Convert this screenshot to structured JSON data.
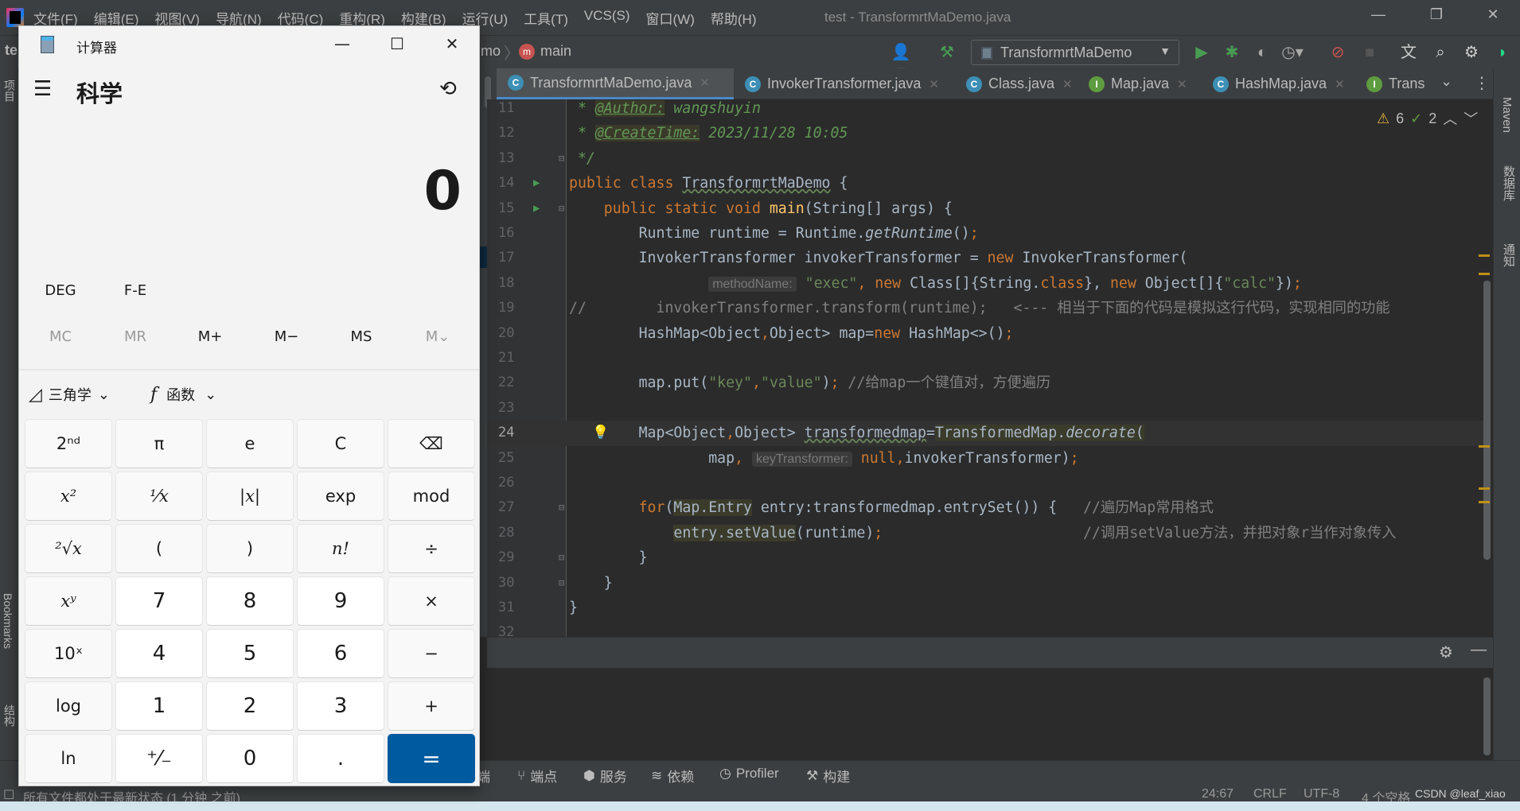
{
  "menubar": {
    "items": [
      "文件(F)",
      "编辑(E)",
      "视图(V)",
      "导航(N)",
      "代码(C)",
      "重构(R)",
      "构建(B)",
      "运行(U)",
      "工具(T)",
      "VCS(S)",
      "窗口(W)",
      "帮助(H)"
    ],
    "title": "test - TransformrtMaDemo.java"
  },
  "toolbar": {
    "breadcrumb_project": "te",
    "breadcrumb_class": "mo",
    "breadcrumb_method": "main",
    "run_config": "TransformrtMaDemo"
  },
  "tabs": [
    {
      "label": "TransformrtMaDemo.java",
      "icon": "C",
      "color": "#3d8fb5",
      "active": true
    },
    {
      "label": "InvokerTransformer.java",
      "icon": "C",
      "color": "#3d8fb5"
    },
    {
      "label": "Class.java",
      "icon": "C",
      "color": "#3d8fb5"
    },
    {
      "label": "Map.java",
      "icon": "I",
      "color": "#5e9c3f"
    },
    {
      "label": "HashMap.java",
      "icon": "C",
      "color": "#3d8fb5"
    },
    {
      "label": "Trans",
      "icon": "I",
      "color": "#5e9c3f"
    }
  ],
  "inspections": {
    "warnings": "6",
    "weak_warnings": "2"
  },
  "code": [
    {
      "n": "11",
      "t": [
        [
          " * ",
          "doc"
        ],
        [
          "@Author:",
          "doctag"
        ],
        [
          " wangshuyin",
          "doc"
        ]
      ]
    },
    {
      "n": "12",
      "t": [
        [
          " * ",
          "doc"
        ],
        [
          "@CreateTime:",
          "doctag"
        ],
        [
          " 2023/11/28 10:05",
          "doc"
        ]
      ]
    },
    {
      "n": "13",
      "t": [
        [
          " */",
          "doc"
        ]
      ],
      "fold": true
    },
    {
      "n": "14",
      "t": [
        [
          "public class ",
          "kw"
        ],
        [
          "TransformrtMaDemo",
          "wavy"
        ],
        [
          " {",
          ""
        ]
      ],
      "run": true
    },
    {
      "n": "15",
      "t": [
        [
          "    public static void ",
          "kw"
        ],
        [
          "main",
          "fn"
        ],
        [
          "(String[] args) {",
          ""
        ]
      ],
      "run": true,
      "fold": true
    },
    {
      "n": "16",
      "t": [
        [
          "        Runtime runtime = Runtime.",
          ""
        ],
        [
          "getRuntime",
          "ital"
        ],
        [
          "()",
          ""
        ],
        [
          ";",
          "kw"
        ]
      ]
    },
    {
      "n": "17",
      "t": [
        [
          "        InvokerTransformer invokerTransformer = ",
          ""
        ],
        [
          "new ",
          "kw"
        ],
        [
          "InvokerTransformer(",
          ""
        ]
      ]
    },
    {
      "n": "18",
      "t": [
        [
          "                ",
          ""
        ],
        [
          "methodName:",
          "hint"
        ],
        [
          " ",
          ""
        ],
        [
          "\"exec\"",
          "str"
        ],
        [
          ", ",
          "kw"
        ],
        [
          "new ",
          "kw"
        ],
        [
          "Class[]{String.",
          ""
        ],
        [
          "class",
          "kw"
        ],
        [
          "}, ",
          ""
        ],
        [
          "new ",
          "kw"
        ],
        [
          "Object[]{",
          ""
        ],
        [
          "\"calc\"",
          "str"
        ],
        [
          "})",
          ""
        ],
        [
          ";",
          "kw"
        ]
      ]
    },
    {
      "n": "19",
      "t": [
        [
          "//        invokerTransformer.transform(runtime);   <--- 相当于下面的代码是模拟这行代码，实现相同的功能",
          "cmt"
        ]
      ]
    },
    {
      "n": "20",
      "t": [
        [
          "        HashMap<Object",
          ""
        ],
        [
          ",",
          "kw"
        ],
        [
          "Object> map=",
          ""
        ],
        [
          "new ",
          "kw"
        ],
        [
          "HashMap<>()",
          ""
        ],
        [
          ";",
          "kw"
        ]
      ]
    },
    {
      "n": "21",
      "t": []
    },
    {
      "n": "22",
      "t": [
        [
          "        map.put(",
          ""
        ],
        [
          "\"key\"",
          "str"
        ],
        [
          ",",
          "kw"
        ],
        [
          "\"value\"",
          "str"
        ],
        [
          ")",
          ""
        ],
        [
          "; ",
          "kw"
        ],
        [
          "//给map一个键值对，方便遍历",
          "cmt"
        ]
      ]
    },
    {
      "n": "23",
      "t": []
    },
    {
      "n": "24",
      "t": [
        [
          "        Map<Object",
          ""
        ],
        [
          ",",
          "kw"
        ],
        [
          "Object> ",
          ""
        ],
        [
          "transformedmap",
          "wavy"
        ],
        [
          "=",
          ""
        ],
        [
          "TransformedMap.",
          "hl"
        ],
        [
          "decorate",
          "hl ital"
        ],
        [
          "(",
          "hl"
        ]
      ],
      "current": true,
      "bulb": true
    },
    {
      "n": "25",
      "t": [
        [
          "                map",
          ""
        ],
        [
          ", ",
          "kw"
        ],
        [
          "keyTransformer:",
          "hint"
        ],
        [
          " null",
          "kw"
        ],
        [
          ",",
          "kw"
        ],
        [
          "invokerTransformer)",
          ""
        ],
        [
          ";",
          "kw"
        ]
      ]
    },
    {
      "n": "26",
      "t": []
    },
    {
      "n": "27",
      "t": [
        [
          "        ",
          ""
        ],
        [
          "for",
          "kw"
        ],
        [
          "(",
          ""
        ],
        [
          "Map.Entry",
          "hl"
        ],
        [
          " entry:transformedmap.entrySet()) {   ",
          ""
        ],
        [
          "//遍历Map常用格式",
          "cmt"
        ]
      ],
      "fold": true
    },
    {
      "n": "28",
      "t": [
        [
          "            ",
          ""
        ],
        [
          "entry.setValue",
          "hl"
        ],
        [
          "(runtime)",
          ""
        ],
        [
          ";",
          "kw"
        ],
        [
          "                       ",
          ""
        ],
        [
          "//调用setValue方法，并把对象r当作对象传入",
          "cmt"
        ]
      ]
    },
    {
      "n": "29",
      "t": [
        [
          "        }",
          ""
        ]
      ],
      "fold": true
    },
    {
      "n": "30",
      "t": [
        [
          "    }",
          ""
        ]
      ],
      "fold": true
    },
    {
      "n": "31",
      "t": [
        [
          "}",
          ""
        ]
      ]
    },
    {
      "n": "32",
      "t": []
    }
  ],
  "left_strip": {
    "project": "项目",
    "bookmarks": "Bookmarks",
    "structure": "结构"
  },
  "right_strip": {
    "maven": "Maven",
    "database": "数据库",
    "notifications": "通知"
  },
  "bottom_toolbar": [
    "终端",
    "端点",
    "服务",
    "依赖",
    "Profiler",
    "构建"
  ],
  "statusbar": {
    "message": "所有文件都处于最新状态 (1 分钟 之前)",
    "position": "24:67",
    "line_sep": "CRLF",
    "encoding": "UTF-8",
    "indent": "4 个空格",
    "watermark": "CSDN @leaf_xiao"
  },
  "calculator": {
    "title": "计算器",
    "mode": "科学",
    "display": "0",
    "angle": "DEG",
    "fe": "F-E",
    "memory": [
      "MC",
      "MR",
      "M+",
      "M−",
      "MS",
      "M⌄"
    ],
    "trig": "三角学",
    "func": "函数",
    "keys": [
      [
        "2ⁿᵈ",
        "π",
        "e",
        "C",
        "⌫"
      ],
      [
        "x²",
        "¹⁄x",
        "|x|",
        "exp",
        "mod"
      ],
      [
        "²√x",
        "(",
        ")",
        "n!",
        "÷"
      ],
      [
        "xʸ",
        "7",
        "8",
        "9",
        "×"
      ],
      [
        "10ˣ",
        "4",
        "5",
        "6",
        "−"
      ],
      [
        "log",
        "1",
        "2",
        "3",
        "+"
      ],
      [
        "ln",
        "⁺⁄₋",
        "0",
        ".",
        "="
      ]
    ],
    "accent": "#005a9e"
  }
}
